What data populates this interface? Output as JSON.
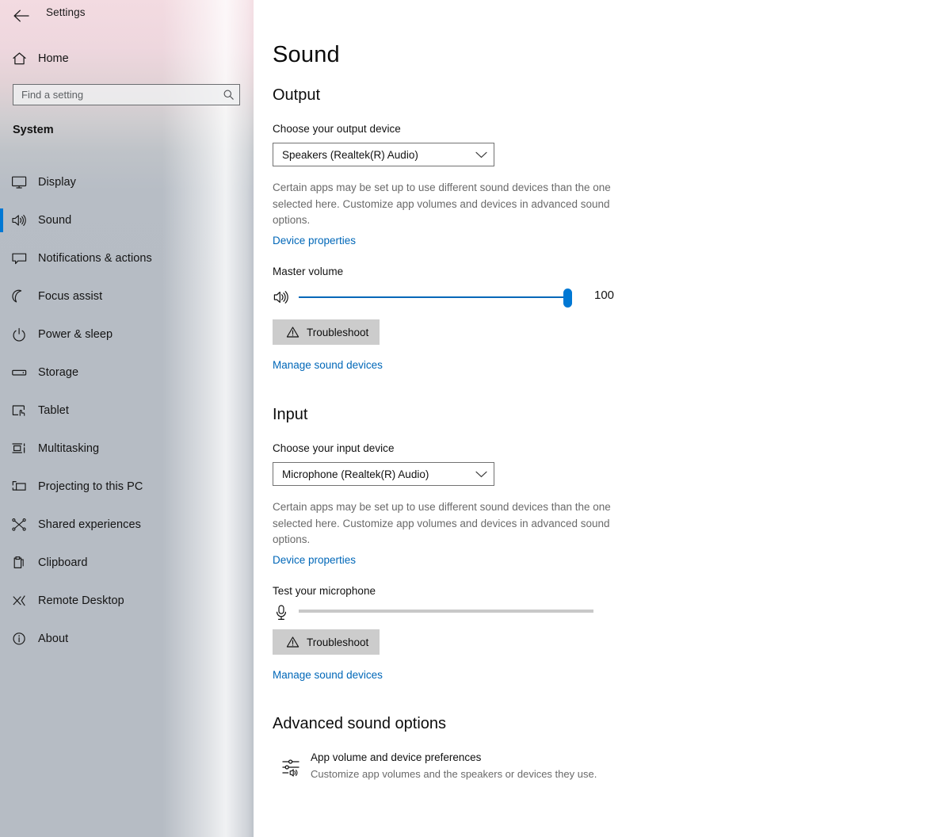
{
  "window": {
    "title": "Settings",
    "back_icon": "back-arrow-icon"
  },
  "sidebar": {
    "home": {
      "label": "Home",
      "icon": "home-icon"
    },
    "search": {
      "placeholder": "Find a setting",
      "value": "",
      "icon": "search-icon"
    },
    "group_title": "System",
    "accent_color": "#0078d4",
    "items": [
      {
        "label": "Display",
        "icon": "monitor-icon",
        "selected": false
      },
      {
        "label": "Sound",
        "icon": "speaker-icon",
        "selected": true
      },
      {
        "label": "Notifications & actions",
        "icon": "chat-bubble-icon",
        "selected": false
      },
      {
        "label": "Focus assist",
        "icon": "moon-icon",
        "selected": false
      },
      {
        "label": "Power & sleep",
        "icon": "power-icon",
        "selected": false
      },
      {
        "label": "Storage",
        "icon": "drive-icon",
        "selected": false
      },
      {
        "label": "Tablet",
        "icon": "tablet-hand-icon",
        "selected": false
      },
      {
        "label": "Multitasking",
        "icon": "multitasking-icon",
        "selected": false
      },
      {
        "label": "Projecting to this PC",
        "icon": "project-screen-icon",
        "selected": false
      },
      {
        "label": "Shared experiences",
        "icon": "share-nodes-icon",
        "selected": false
      },
      {
        "label": "Clipboard",
        "icon": "clipboard-icon",
        "selected": false
      },
      {
        "label": "Remote Desktop",
        "icon": "remote-desktop-icon",
        "selected": false
      },
      {
        "label": "About",
        "icon": "info-circle-icon",
        "selected": false
      }
    ]
  },
  "main": {
    "page_title": "Sound",
    "output": {
      "heading": "Output",
      "device_label": "Choose your output device",
      "device_value": "Speakers (Realtek(R) Audio)",
      "description": "Certain apps may be set up to use different sound devices than the one selected here. Customize app volumes and devices in advanced sound options.",
      "device_properties_link": "Device properties",
      "volume_label": "Master volume",
      "volume_value": "100",
      "volume_icon": "speaker-volume-icon",
      "troubleshoot_label": "Troubleshoot",
      "troubleshoot_icon": "warning-triangle-icon",
      "manage_link": "Manage sound devices"
    },
    "input": {
      "heading": "Input",
      "device_label": "Choose your input device",
      "device_value": "Microphone (Realtek(R) Audio)",
      "description": "Certain apps may be set up to use different sound devices than the one selected here. Customize app volumes and devices in advanced sound options.",
      "device_properties_link": "Device properties",
      "test_label": "Test your microphone",
      "test_level": "0",
      "mic_icon": "microphone-icon",
      "troubleshoot_label": "Troubleshoot",
      "troubleshoot_icon": "warning-triangle-icon",
      "manage_link": "Manage sound devices"
    },
    "advanced": {
      "heading": "Advanced sound options",
      "app_volume_title": "App volume and device preferences",
      "app_volume_sub": "Customize app volumes and the speakers or devices they use.",
      "app_volume_icon": "audio-mixer-icon"
    }
  }
}
